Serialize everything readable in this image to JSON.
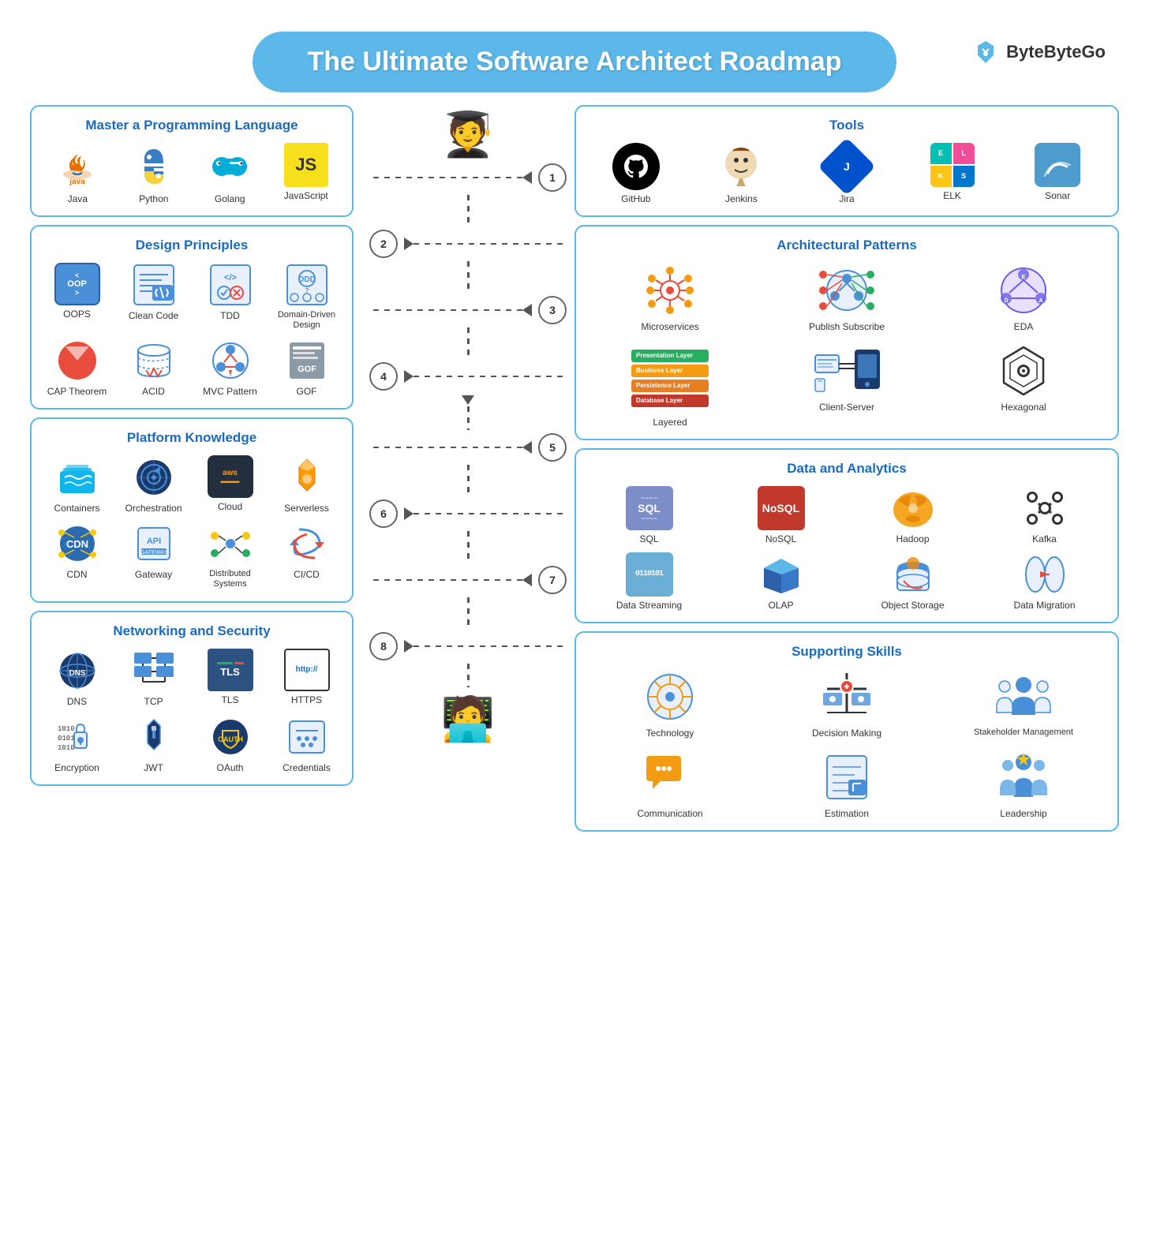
{
  "title": "The Ultimate Software Architect Roadmap",
  "brand": "ByteByteGo",
  "sections": {
    "left": {
      "programming": {
        "title": "Master a Programming Language",
        "items": [
          {
            "label": "Java",
            "icon": "java"
          },
          {
            "label": "Python",
            "icon": "python"
          },
          {
            "label": "Golang",
            "icon": "golang"
          },
          {
            "label": "JavaScript",
            "icon": "javascript"
          }
        ]
      },
      "design": {
        "title": "Design Principles",
        "items": [
          {
            "label": "OOPS",
            "icon": "oops"
          },
          {
            "label": "Clean Code",
            "icon": "cleancode"
          },
          {
            "label": "TDD",
            "icon": "tdd"
          },
          {
            "label": "Domain-Driven Design",
            "icon": "ddd"
          },
          {
            "label": "CAP Theorem",
            "icon": "cap"
          },
          {
            "label": "ACID",
            "icon": "acid"
          },
          {
            "label": "MVC Pattern",
            "icon": "mvc"
          },
          {
            "label": "GOF",
            "icon": "gof"
          }
        ]
      },
      "platform": {
        "title": "Platform Knowledge",
        "items": [
          {
            "label": "Containers",
            "icon": "containers"
          },
          {
            "label": "Orchestration",
            "icon": "orchestration"
          },
          {
            "label": "Cloud",
            "icon": "cloud"
          },
          {
            "label": "Serverless",
            "icon": "serverless"
          },
          {
            "label": "CDN",
            "icon": "cdn"
          },
          {
            "label": "Gateway",
            "icon": "gateway"
          },
          {
            "label": "Distributed Systems",
            "icon": "distributed"
          },
          {
            "label": "CI/CD",
            "icon": "cicd"
          }
        ]
      },
      "networking": {
        "title": "Networking and Security",
        "items": [
          {
            "label": "DNS",
            "icon": "dns"
          },
          {
            "label": "TCP",
            "icon": "tcp"
          },
          {
            "label": "TLS",
            "icon": "tls"
          },
          {
            "label": "HTTPS",
            "icon": "https"
          },
          {
            "label": "Encryption",
            "icon": "encryption"
          },
          {
            "label": "JWT",
            "icon": "jwt"
          },
          {
            "label": "OAuth",
            "icon": "oauth"
          },
          {
            "label": "Credentials",
            "icon": "credentials"
          }
        ]
      }
    },
    "right": {
      "tools": {
        "title": "Tools",
        "items": [
          {
            "label": "GitHub",
            "icon": "github"
          },
          {
            "label": "Jenkins",
            "icon": "jenkins"
          },
          {
            "label": "Jira",
            "icon": "jira"
          },
          {
            "label": "ELK",
            "icon": "elk"
          },
          {
            "label": "Sonar",
            "icon": "sonar"
          }
        ]
      },
      "architectural": {
        "title": "Architectural Patterns",
        "items": [
          {
            "label": "Microservices",
            "icon": "microservices"
          },
          {
            "label": "Publish Subscribe",
            "icon": "pubsub"
          },
          {
            "label": "EDA",
            "icon": "eda"
          },
          {
            "label": "Layered",
            "icon": "layered"
          },
          {
            "label": "Client-Server",
            "icon": "clientserver"
          },
          {
            "label": "Hexagonal",
            "icon": "hexagonal"
          }
        ]
      },
      "data": {
        "title": "Data and Analytics",
        "items": [
          {
            "label": "SQL",
            "icon": "sql"
          },
          {
            "label": "NoSQL",
            "icon": "nosql"
          },
          {
            "label": "Hadoop",
            "icon": "hadoop"
          },
          {
            "label": "Kafka",
            "icon": "kafka"
          },
          {
            "label": "Data Streaming",
            "icon": "datastreaming"
          },
          {
            "label": "OLAP",
            "icon": "olap"
          },
          {
            "label": "Object Storage",
            "icon": "objectstorage"
          },
          {
            "label": "Data Migration",
            "icon": "datamigration"
          }
        ]
      },
      "skills": {
        "title": "Supporting Skills",
        "items": [
          {
            "label": "Technology",
            "icon": "technology"
          },
          {
            "label": "Decision Making",
            "icon": "decisionmaking"
          },
          {
            "label": "Stakeholder Management",
            "icon": "stakeholder"
          },
          {
            "label": "Communication",
            "icon": "communication"
          },
          {
            "label": "Estimation",
            "icon": "estimation"
          },
          {
            "label": "Leadership",
            "icon": "leadership"
          }
        ]
      }
    },
    "steps": [
      "1",
      "2",
      "3",
      "4",
      "5",
      "6",
      "7",
      "8"
    ]
  }
}
